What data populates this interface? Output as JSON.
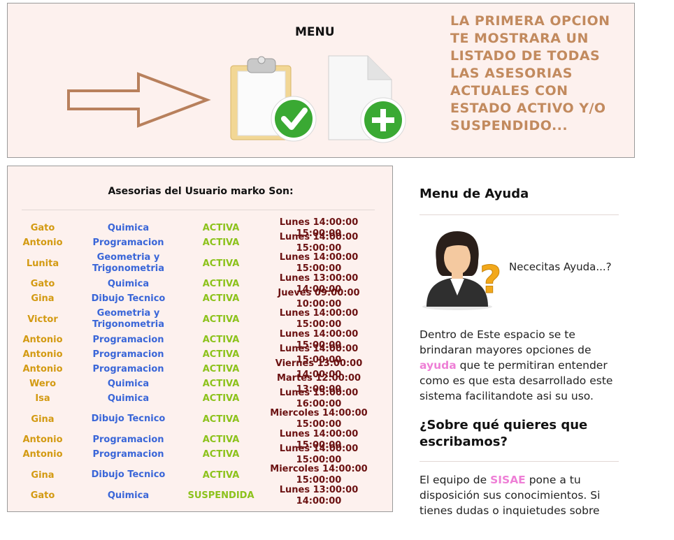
{
  "menu": {
    "title": "MENU",
    "info_text": "LA PRIMERA OPCION TE MOSTRARA UN LISTADO DE TODAS LAS ASESORIAS ACTUALES CON ESTADO ACTIVO Y/O SUSPENDIDO...",
    "icons": [
      "arrow-right-icon",
      "clipboard-check-icon",
      "new-document-icon"
    ]
  },
  "asesorias": {
    "title": "Asesorias del Usuario marko Son:",
    "rows": [
      {
        "name": "Gato",
        "subject": "Quimica",
        "status": "ACTIVA",
        "time": "Lunes 14:00:00 15:00:00"
      },
      {
        "name": "Antonio",
        "subject": "Programacion",
        "status": "ACTIVA",
        "time": "Lunes 14:00:00 15:00:00"
      },
      {
        "name": "Lunita",
        "subject": "Geometria y Trigonometria",
        "status": "ACTIVA",
        "time": "Lunes 14:00:00 15:00:00"
      },
      {
        "name": "Gato",
        "subject": "Quimica",
        "status": "ACTIVA",
        "time": "Lunes 13:00:00 14:00:00"
      },
      {
        "name": "Gina",
        "subject": "Dibujo Tecnico",
        "status": "ACTIVA",
        "time": "Jueves 09:00:00 10:00:00"
      },
      {
        "name": "Victor",
        "subject": "Geometria y Trigonometria",
        "status": "ACTIVA",
        "time": "Lunes 14:00:00 15:00:00"
      },
      {
        "name": "Antonio",
        "subject": "Programacion",
        "status": "ACTIVA",
        "time": "Lunes 14:00:00 15:00:00"
      },
      {
        "name": "Antonio",
        "subject": "Programacion",
        "status": "ACTIVA",
        "time": "Lunes 14:00:00 15:00:00"
      },
      {
        "name": "Antonio",
        "subject": "Programacion",
        "status": "ACTIVA",
        "time": "Viernes 13:00:00 14:00:00"
      },
      {
        "name": "Wero",
        "subject": "Quimica",
        "status": "ACTIVA",
        "time": "Martes 12:00:00 13:00:00"
      },
      {
        "name": "Isa",
        "subject": "Quimica",
        "status": "ACTIVA",
        "time": "Lunes 15:00:00 16:00:00"
      },
      {
        "name": "Gina",
        "subject": "Dibujo Tecnico",
        "status": "ACTIVA",
        "time": "Miercoles 14:00:00 15:00:00"
      },
      {
        "name": "Antonio",
        "subject": "Programacion",
        "status": "ACTIVA",
        "time": "Lunes 14:00:00 15:00:00"
      },
      {
        "name": "Antonio",
        "subject": "Programacion",
        "status": "ACTIVA",
        "time": "Lunes 14:00:00 15:00:00"
      },
      {
        "name": "Gina",
        "subject": "Dibujo Tecnico",
        "status": "ACTIVA",
        "time": "Miercoles 14:00:00 15:00:00"
      },
      {
        "name": "Gato",
        "subject": "Quimica",
        "status": "SUSPENDIDA",
        "time": "Lunes 13:00:00 14:00:00"
      }
    ]
  },
  "help": {
    "title": "Menu de Ayuda",
    "question": "Nececitas Ayuda...?",
    "para_before": "Dentro de Este espacio se te brindaran mayores opciones de ",
    "para_highlight": "ayuda",
    "para_after": " que te permitiran entender como es que esta desarrollado este sistema facilitandote asi su uso.",
    "sobre_title": "¿Sobre qué quieres que escribamos?",
    "team_before": "El equipo de ",
    "team_highlight": "SISAE",
    "team_after": " pone a tu disposición sus conocimientos. Si tienes dudas o inquietudes sobre algunos de"
  },
  "colors": {
    "panel_bg": "#fdf1ee",
    "name": "#d39a12",
    "subject": "#3a66d8",
    "status": "#8cc21b",
    "time": "#6b1212",
    "info": "#c28a5e",
    "highlight": "#ee7fd6"
  }
}
